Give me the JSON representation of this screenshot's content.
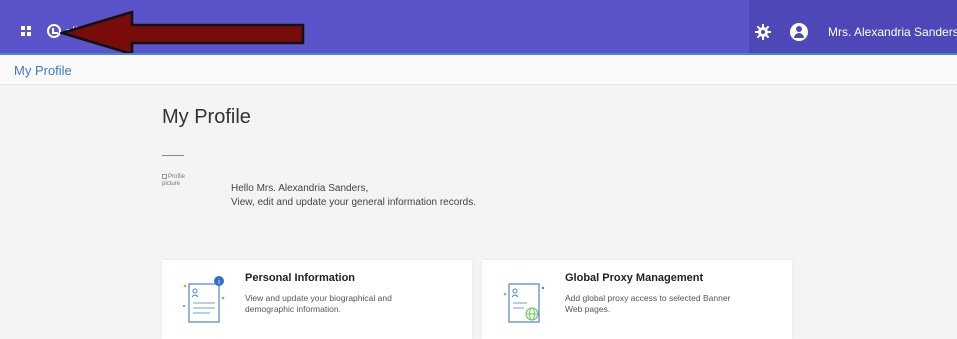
{
  "header": {
    "logo_text": "ell",
    "user_name": "Mrs. Alexandria Sanders",
    "colors": {
      "primary": "#5a53c9",
      "primary_dark": "#4d47b8",
      "accent": "#4b86ca"
    }
  },
  "breadcrumb": "My Profile",
  "main": {
    "title": "My Profile",
    "profile_picture_alt": "Profile picture",
    "greeting": "Hello Mrs. Alexandria Sanders,",
    "intro": "View, edit and update your general information records."
  },
  "cards": [
    {
      "title": "Personal Information",
      "desc_line1": "View and update your biographical and",
      "desc_line2": "demographic information.",
      "icon": "person-document-icon"
    },
    {
      "title": "Global Proxy Management",
      "desc_line1": "Add global proxy access to selected Banner",
      "desc_line2": "Web pages.",
      "icon": "person-globe-document-icon"
    }
  ]
}
